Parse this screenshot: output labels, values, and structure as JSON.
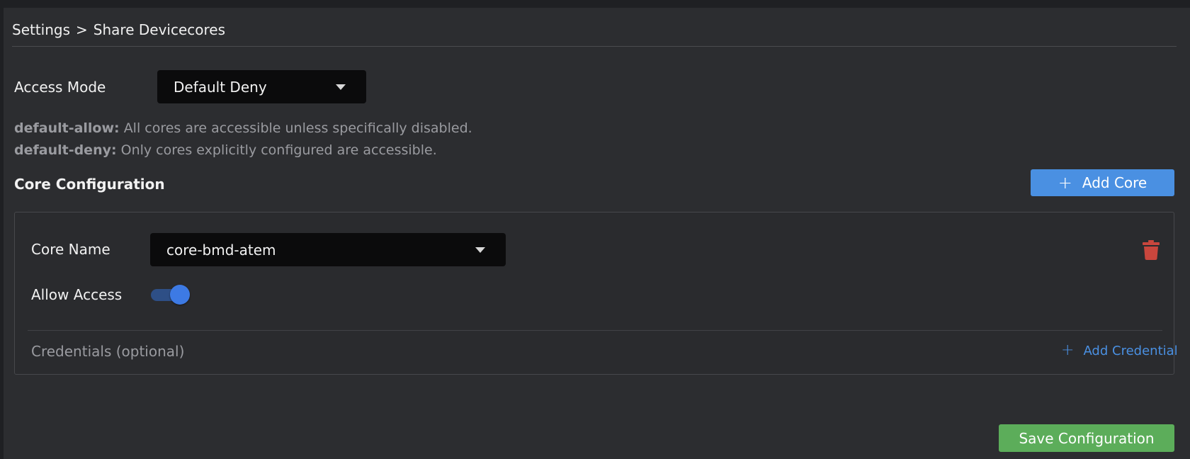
{
  "breadcrumb": {
    "root": "Settings",
    "separator": ">",
    "current": "Share Devicecores"
  },
  "access_mode": {
    "label": "Access Mode",
    "value": "Default Deny"
  },
  "help": [
    {
      "key": "default-allow:",
      "text": "All cores are accessible unless specifically disabled."
    },
    {
      "key": "default-deny:",
      "text": "Only cores explicitly configured are accessible."
    }
  ],
  "core_config": {
    "title": "Core Configuration",
    "add_core_label": "Add Core",
    "core": {
      "name_label": "Core Name",
      "name_value": "core-bmd-atem",
      "allow_label": "Allow Access",
      "allow_access": true,
      "credentials_label": "Credentials (optional)",
      "add_credential_label": "Add Credential"
    }
  },
  "save_label": "Save Configuration",
  "colors": {
    "accent": "#4a90e2",
    "save": "#5cad5a",
    "delete": "#c9463d",
    "toggle_on": "#3d7ae4"
  },
  "icons": {
    "plus": "plus-icon",
    "caret": "chevron-down-icon",
    "trash": "trash-icon"
  }
}
